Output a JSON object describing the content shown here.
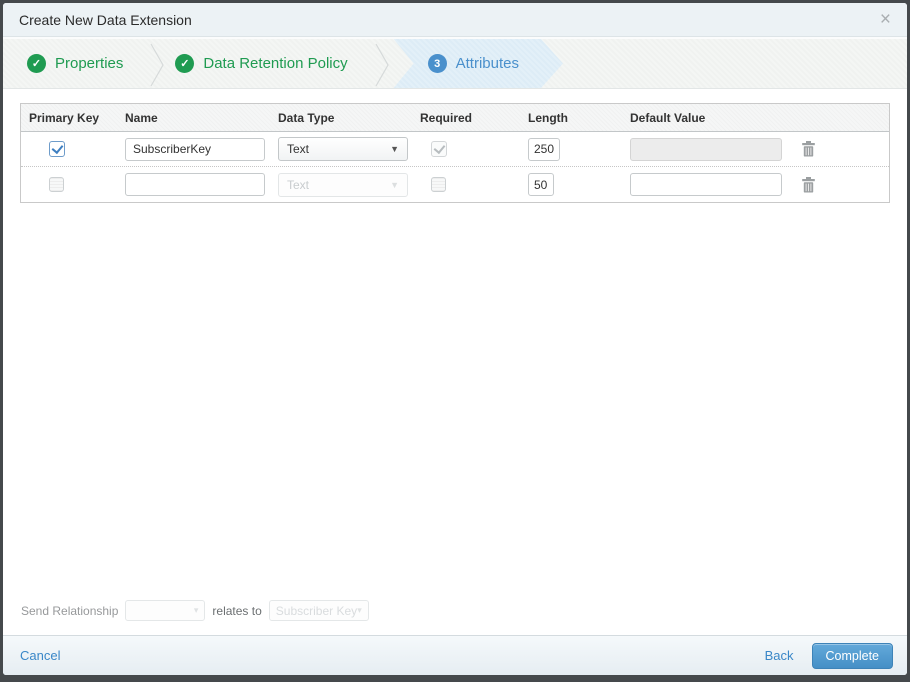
{
  "modal": {
    "title": "Create New Data Extension",
    "close_glyph": "×"
  },
  "steps": [
    {
      "label": "Properties",
      "status": "complete",
      "indicator": "✓"
    },
    {
      "label": "Data Retention Policy",
      "status": "complete",
      "indicator": "✓"
    },
    {
      "label": "Attributes",
      "status": "current",
      "indicator": "3"
    }
  ],
  "colors": {
    "step_complete_green": "#1f9b51",
    "step_current_blue": "#4a90cc",
    "link_blue": "#3a87c8",
    "complete_button_blue": "#4f9ad1",
    "checkbox_check_blue": "#3e7fc1"
  },
  "table": {
    "headers": [
      "Primary Key",
      "Name",
      "Data Type",
      "Required",
      "Length",
      "Default Value"
    ],
    "rows": [
      {
        "primary_key": true,
        "name": "SubscriberKey",
        "data_type": "Text",
        "data_type_disabled": false,
        "required": true,
        "required_disabled": true,
        "length": "250",
        "default_value": "",
        "default_disabled": true
      },
      {
        "primary_key": false,
        "name": "",
        "data_type": "Text",
        "data_type_disabled": true,
        "required": false,
        "required_disabled": false,
        "length": "50",
        "default_value": "",
        "default_disabled": false
      }
    ],
    "caret_glyph": "▼"
  },
  "send_relationship": {
    "label": "Send Relationship",
    "field_value": "",
    "relates_to_label": "relates to",
    "target_value": "Subscriber Key",
    "caret_glyph": "▾"
  },
  "footer": {
    "cancel_label": "Cancel",
    "back_label": "Back",
    "complete_label": "Complete"
  }
}
